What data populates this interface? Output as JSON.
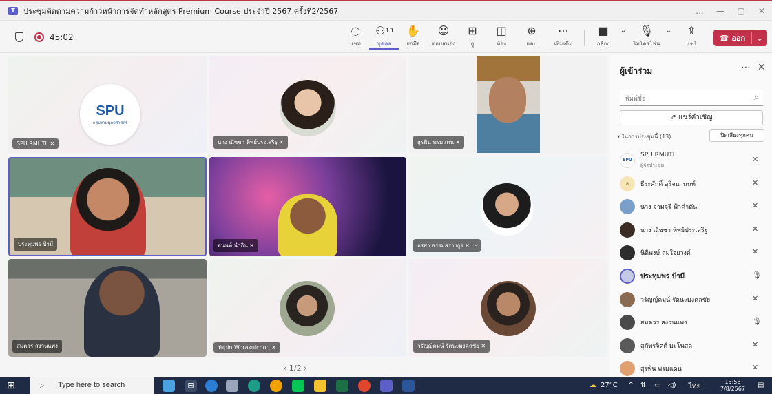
{
  "window": {
    "title": "ประชุมติดตามความก้าวหน้าการจัดทำหลักสูตร Premium Course ประจำปี 2567 ครั้งที่2/2567",
    "app_icon": "teams-icon",
    "controls": [
      "...",
      "—",
      "▢",
      "✕"
    ]
  },
  "toolbar": {
    "timer": "45:02",
    "buttons": [
      {
        "icon": "chat-icon",
        "label": "แชท"
      },
      {
        "icon": "people-icon",
        "label": "บุคคล",
        "count": "13",
        "active": true
      },
      {
        "icon": "raise-hand-icon",
        "label": "ยกมือ"
      },
      {
        "icon": "emoji-icon",
        "label": "ตอบสนอง"
      },
      {
        "icon": "view-icon",
        "label": "ดู"
      },
      {
        "icon": "rooms-icon",
        "label": "ห้อง"
      },
      {
        "icon": "apps-icon",
        "label": "แอป"
      },
      {
        "icon": "more-icon",
        "label": "เพิ่มเติม"
      }
    ],
    "camera_label": "กล้อง",
    "mic_label": "ไมโครโฟน",
    "share_label": "แชร์",
    "leave_label": "ออก"
  },
  "tiles": [
    {
      "name": "SPU RMUTL",
      "logo_text": "SPU",
      "logo_sub": "กลุ่มงานนุกรศาสตร์"
    },
    {
      "name": "นาง ณัชชา ทิพย์ประเสริฐ"
    },
    {
      "name": "สุรพิน พรมแดน"
    },
    {
      "name": "ประทุมพร ป้ามี"
    },
    {
      "name": "อนนท์ นำอิน"
    },
    {
      "name": "อรสา ธรรมสรางกูร"
    },
    {
      "name": "สมควร สงวนแพง"
    },
    {
      "name": "Yupin Worakulchon"
    },
    {
      "name": "วรัญญ์คมน์ รัตนะมงคลชัย"
    }
  ],
  "pager": "1/2",
  "panel": {
    "title": "ผู้เข้าร่วม",
    "search_placeholder": "พิมพ์ชื่อ",
    "share_invite": "แชร์คำเชิญ",
    "section_label": "ในการประชุมนี้ (13)",
    "mute_all": "ปิดเสียงทุกคน",
    "participants": [
      {
        "name": "SPU RMUTL",
        "sub": "ผู้จัดประชุม",
        "mic": "muted",
        "avatar": "#ffffff"
      },
      {
        "name": "ธีระศักดิ์ อุริจนานนท์",
        "mic": "muted",
        "avatar": "#f7e6b5",
        "initial": "ธ"
      },
      {
        "name": "นาง จามจุรี ฟ้าคำตัน",
        "mic": "muted",
        "avatar": "#7aa0c9"
      },
      {
        "name": "นาง ณัชชา ทิพย์ประเสริฐ",
        "mic": "muted",
        "avatar": "#3a2b25"
      },
      {
        "name": "นิติพงษ์ สมใจยวงค์",
        "mic": "muted",
        "avatar": "#2d2d2d"
      },
      {
        "name": "ประทุมพร ป้ามี",
        "mic": "on",
        "avatar": "#c4c9e6",
        "bold": true
      },
      {
        "name": "วรัญญ์คมน์ รัตนะมงคลชัย",
        "mic": "muted",
        "avatar": "#8a6a50"
      },
      {
        "name": "สมควร สงวนแพง",
        "mic": "on",
        "avatar": "#4a4a4a"
      },
      {
        "name": "สุภัทรจิตต์ มะโนสด",
        "mic": "muted",
        "avatar": "#5a5a5a"
      },
      {
        "name": "สุรพิน พรมแดน",
        "mic": "muted",
        "avatar": "#e0a070"
      }
    ]
  },
  "taskbar": {
    "search_placeholder": "Type here to search",
    "temperature": "27°C",
    "language": "ไทย",
    "time": "13:58",
    "date": "7/8/2567"
  }
}
